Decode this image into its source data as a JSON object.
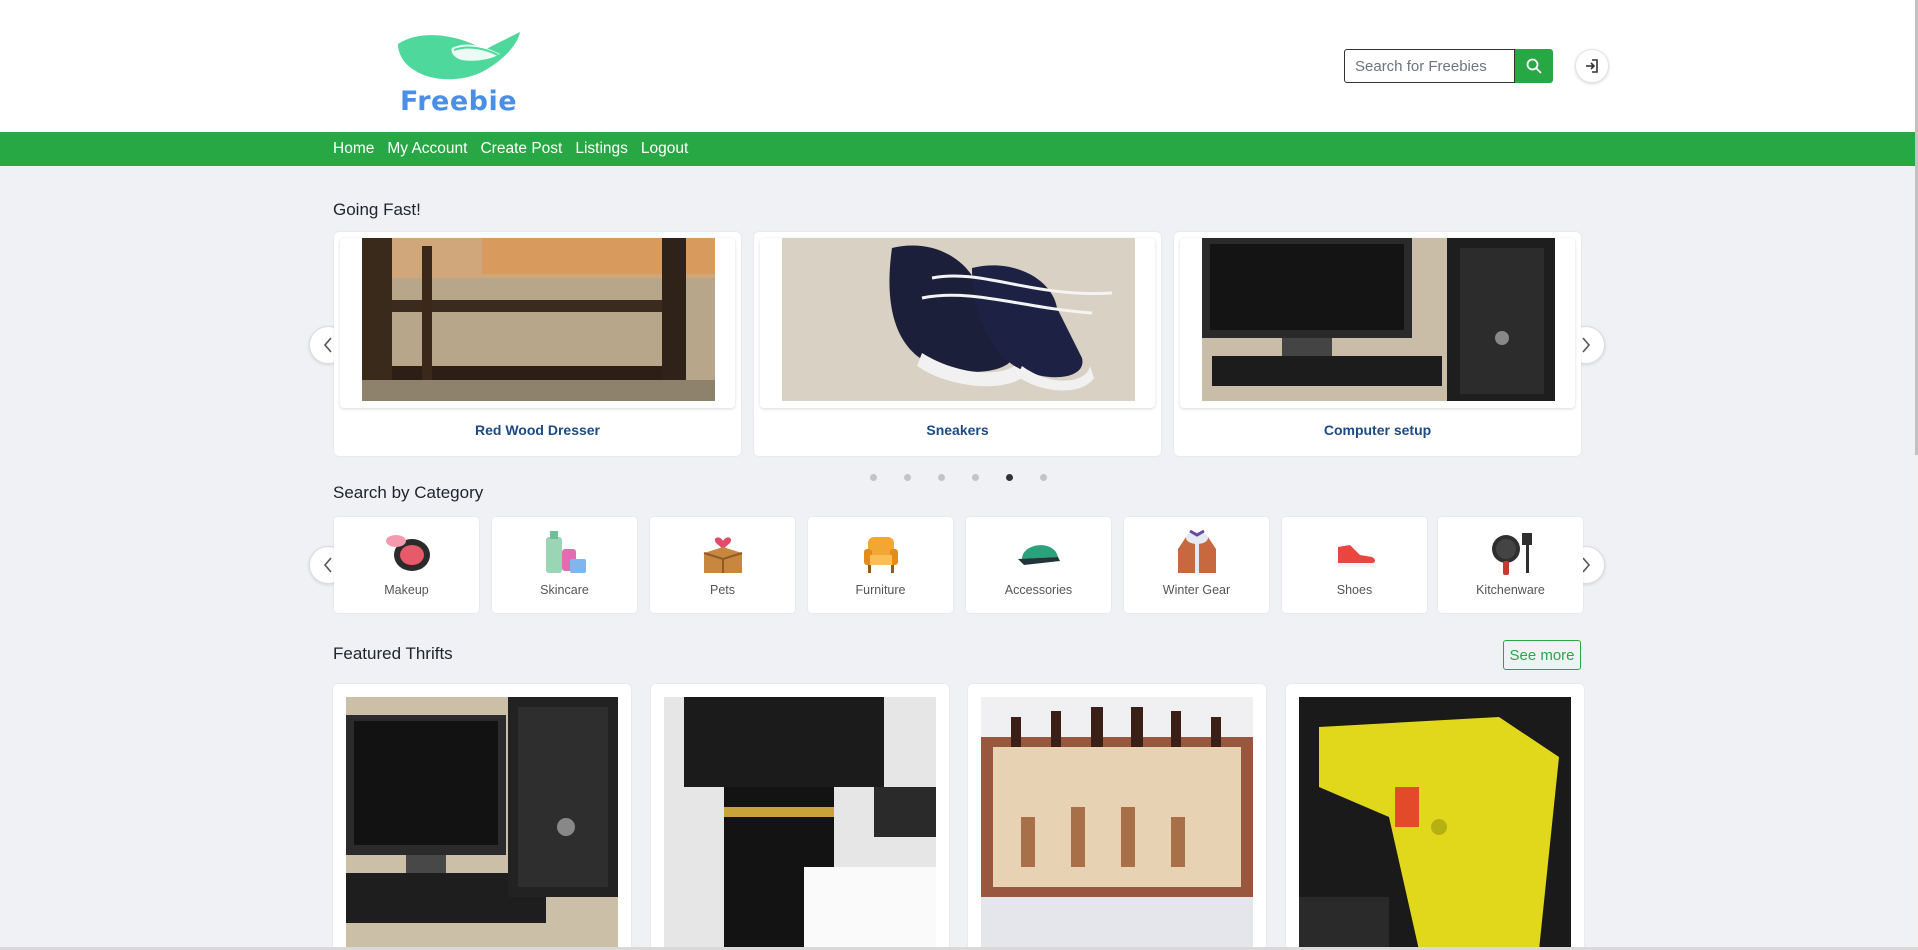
{
  "brand": {
    "name": "Freebie",
    "logo_color": "#4a8fe7",
    "leaf_color": "#4ed89c"
  },
  "search": {
    "placeholder": "Search for Freebies",
    "icon": "search-icon"
  },
  "login_icon": "sign-in-icon",
  "nav": {
    "items": [
      "Home",
      "My Account",
      "Create Post",
      "Listings",
      "Logout"
    ],
    "color": "#28a745"
  },
  "going_fast": {
    "title": "Going Fast!",
    "cards": [
      {
        "title": "Red Wood Dresser"
      },
      {
        "title": "Sneakers"
      },
      {
        "title": "Computer setup"
      }
    ],
    "dots_total": 6,
    "active_dot": 5
  },
  "categories": {
    "title": "Search by Category",
    "items": [
      {
        "label": "Makeup",
        "icon": "makeup-icon"
      },
      {
        "label": "Skincare",
        "icon": "skincare-icon"
      },
      {
        "label": "Pets",
        "icon": "pets-icon"
      },
      {
        "label": "Furniture",
        "icon": "furniture-icon"
      },
      {
        "label": "Accessories",
        "icon": "cap-icon"
      },
      {
        "label": "Winter Gear",
        "icon": "winter-coat-icon"
      },
      {
        "label": "Shoes",
        "icon": "sneaker-icon"
      },
      {
        "label": "Kitchenware",
        "icon": "pan-icon"
      }
    ]
  },
  "featured": {
    "title": "Featured Thrifts",
    "see_more": "See more",
    "items": [
      {
        "image": "computer-photo"
      },
      {
        "image": "nikon-camera-photo"
      },
      {
        "image": "chess-board-photo"
      },
      {
        "image": "nerf-blaster-photo"
      }
    ]
  }
}
